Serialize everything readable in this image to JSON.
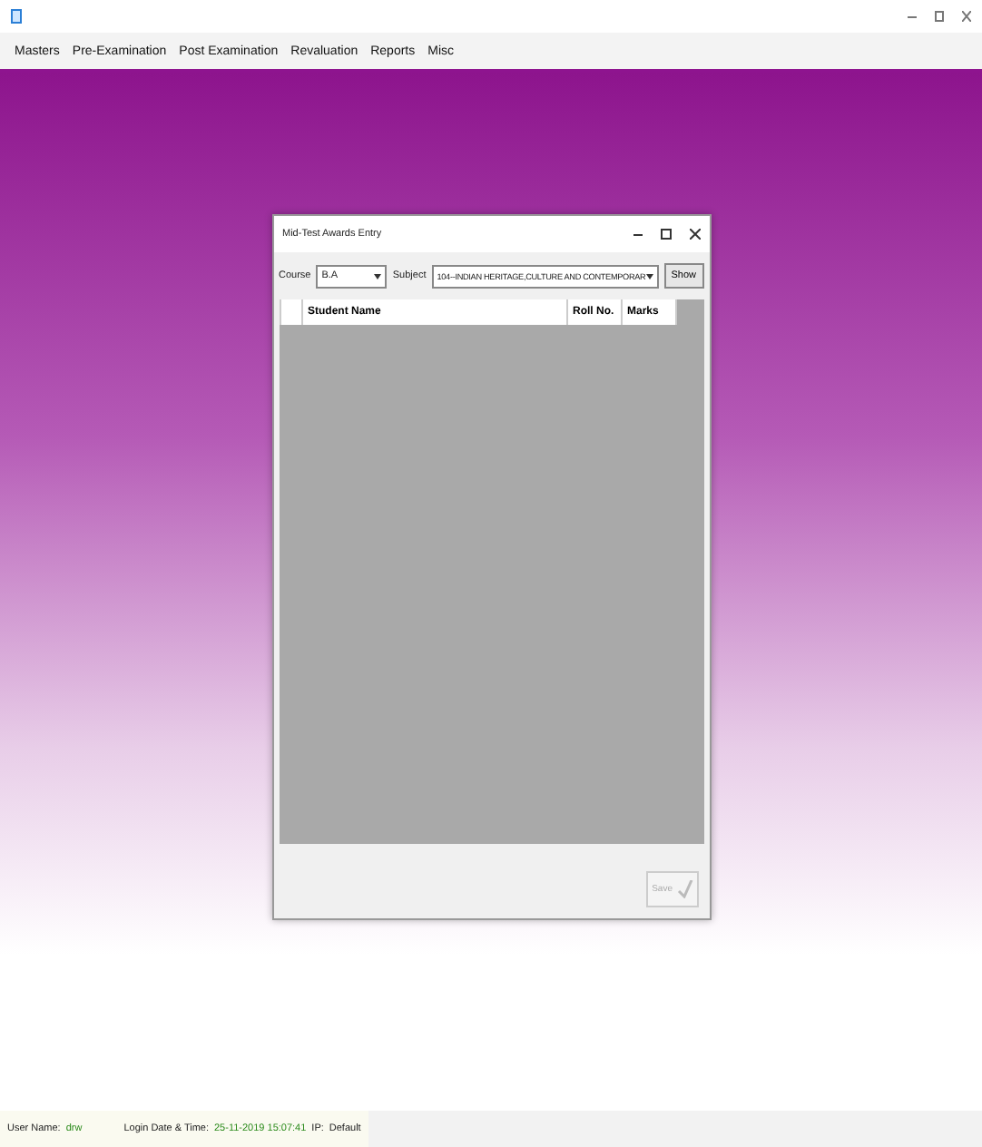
{
  "menu": [
    "Masters",
    "Pre-Examination",
    "Post Examination",
    "Revaluation",
    "Reports",
    "Misc"
  ],
  "dialog": {
    "title": "Mid-Test Awards Entry",
    "course": {
      "label": "Course",
      "value": "B.A"
    },
    "subject": {
      "label": "Subject",
      "value": "104--INDIAN HERITAGE,CULTURE AND CONTEMPORAR"
    },
    "show_button": "Show",
    "columns": [
      "Student Name",
      "Roll No.",
      "Marks"
    ],
    "save": {
      "label": "Save",
      "disabled": true
    }
  },
  "status_bar": {
    "user_label": "User Name:",
    "user": "drw",
    "login_label": "Login Date & Time:",
    "login": "25-11-2019 15:07:41",
    "ip_label": "IP:",
    "ip": "Default"
  }
}
